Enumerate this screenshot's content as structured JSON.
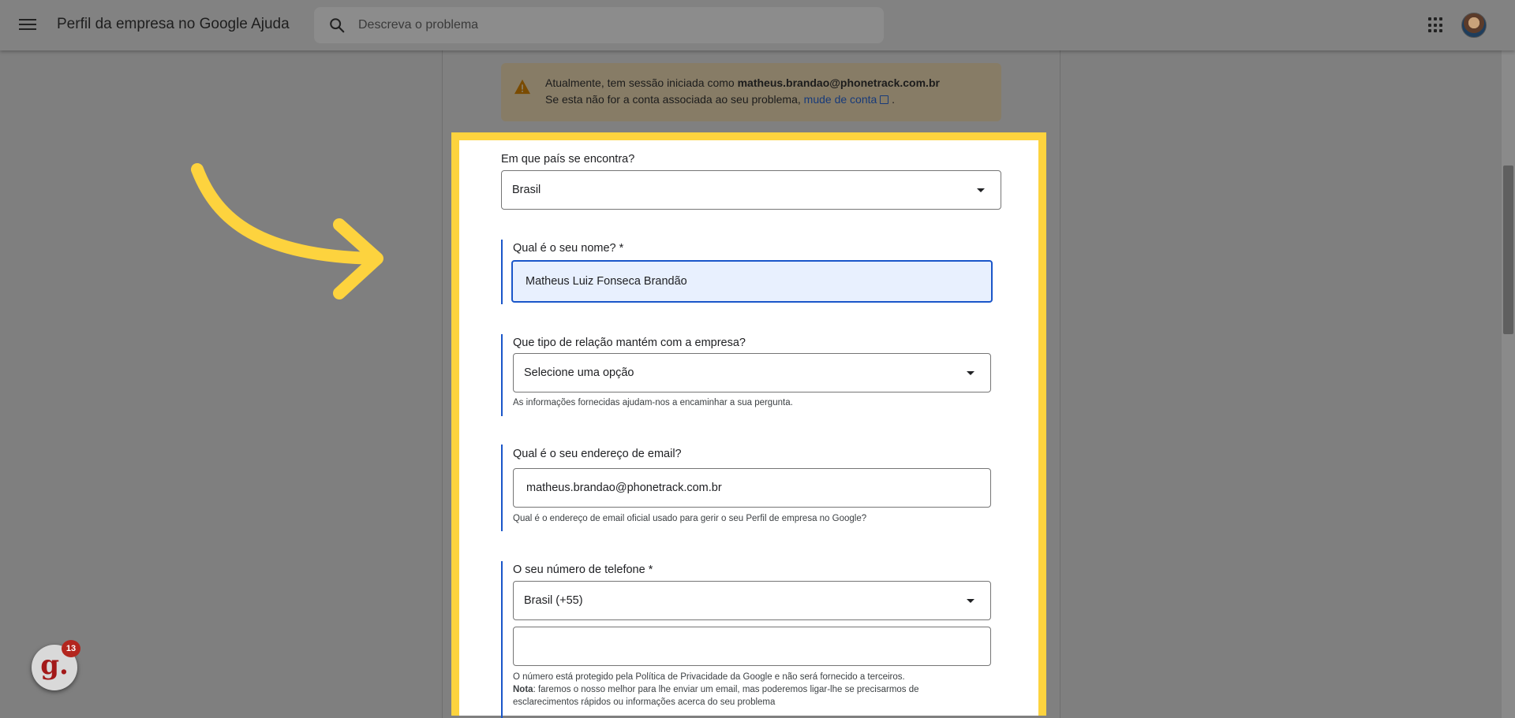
{
  "header": {
    "title": "Perfil da empresa no Google Ajuda",
    "search_placeholder": "Descreva o problema"
  },
  "banner": {
    "line1_prefix": "Atualmente, tem sessão iniciada como",
    "account_email": "matheus.brandao@phonetrack.com.br",
    "line2_prefix": "Se esta não for a conta associada ao seu problema,",
    "switch_link": "mude de conta",
    "line2_suffix": "."
  },
  "form": {
    "country": {
      "label": "Em que país se encontra?",
      "value": "Brasil"
    },
    "name": {
      "label": "Qual é o seu nome? *",
      "value": "Matheus Luiz Fonseca Brandão"
    },
    "relationship": {
      "label": "Que tipo de relação mantém com a empresa?",
      "value": "Selecione uma opção",
      "help": "As informações fornecidas ajudam-nos a encaminhar a sua pergunta."
    },
    "email": {
      "label": "Qual é o seu endereço de email?",
      "value": "matheus.brandao@phonetrack.com.br",
      "help": "Qual é o endereço de email oficial usado para gerir o seu Perfil de empresa no Google?"
    },
    "phone": {
      "label": "O seu número de telefone *",
      "country_code": "Brasil (+55)",
      "value": "",
      "help_line1": "O número está protegido pela Política de Privacidade da Google e não será fornecido a terceiros.",
      "note_label": "Nota",
      "help_line2": ": faremos o nosso melhor para lhe enviar um email, mas poderemos ligar-lhe se precisarmos de",
      "help_line3": "esclarecimentos rápidos ou informações acerca do seu problema"
    }
  },
  "badge": {
    "letter": "g.",
    "count": "13"
  },
  "colors": {
    "highlight": "#fdd33e",
    "accent": "#1a56c9",
    "badge": "#a31919"
  },
  "icons": {
    "menu": "menu-icon",
    "search": "search-icon",
    "apps": "apps-grid-icon",
    "warning": "warning-icon",
    "external_link": "external-link-icon",
    "dropdown": "chevron-down-icon"
  }
}
